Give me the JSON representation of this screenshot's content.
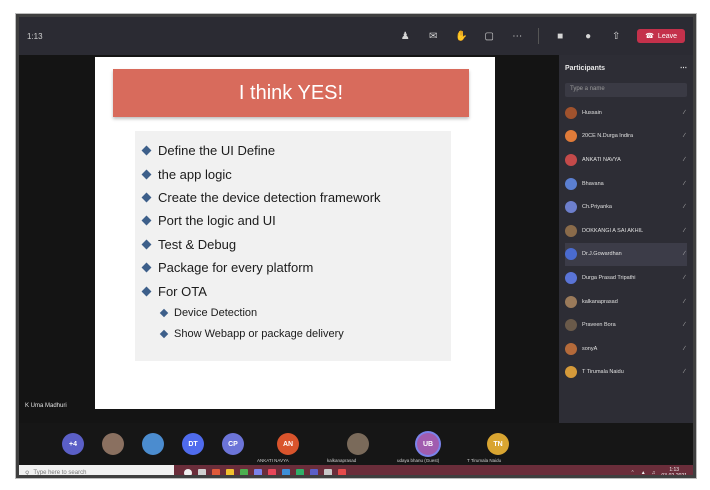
{
  "window": {
    "clock": "1:13"
  },
  "toolbar": {
    "leave_label": "Leave",
    "icons": [
      "people-icon",
      "chat-icon",
      "hand-icon",
      "more-icon",
      "camera-icon",
      "mic-icon",
      "share-icon"
    ]
  },
  "slide": {
    "title": "I think YES!",
    "bullets": [
      "Define the UI Define",
      "the app logic",
      "Create the device detection framework",
      "Port the logic and UI",
      "Test & Debug",
      "Package for every platform",
      "For OTA"
    ],
    "subbullets": [
      "Device Detection",
      "Show Webapp or package delivery"
    ]
  },
  "presenter": {
    "label": "K Uma Madhuri"
  },
  "participants": {
    "title": "Participants",
    "search_placeholder": "Type a name",
    "list": [
      {
        "name": "Hussain",
        "color": "#a0522d"
      },
      {
        "name": "20CE N.Durga Indira",
        "color": "#e07b39"
      },
      {
        "name": "ANKATI NAVYA",
        "color": "#c44a4a"
      },
      {
        "name": "Bhavana",
        "color": "#5b7fd1"
      },
      {
        "name": "Ch.Priyanka",
        "color": "#6d7fcc"
      },
      {
        "name": "DOKKANGI A SAI AKHIL",
        "color": "#8a6b4a"
      },
      {
        "name": "Dr.J.Gowardhan",
        "color": "#4a6bcf"
      },
      {
        "name": "Durga Prasad Tripathi",
        "color": "#5a74d6"
      },
      {
        "name": "kalkanaprasad",
        "color": "#9a7a5a"
      },
      {
        "name": "Praveen Bora",
        "color": "#6a5a4a"
      },
      {
        "name": "sonyA",
        "color": "#b46a3a"
      },
      {
        "name": "T Tirumala Naidu",
        "color": "#d59a3a"
      }
    ]
  },
  "strip": {
    "tiles": [
      {
        "initials": "+4",
        "color": "#5b5fc7"
      },
      {
        "initials": "",
        "color": "#8a7060"
      },
      {
        "initials": "",
        "color": "#4b8ccf"
      },
      {
        "initials": "DT",
        "color": "#4f6bed"
      },
      {
        "initials": "CP",
        "color": "#6c74d8"
      }
    ],
    "named": [
      {
        "initials": "AN",
        "color": "#d9542c",
        "name": "ANKATI NAVYA"
      },
      {
        "initials": "",
        "color": "#7a6a5a",
        "name": "kalkanaprasad"
      },
      {
        "initials": "UB",
        "color": "#a15caf",
        "name": "udaya bhanu (Guest)"
      },
      {
        "initials": "TN",
        "color": "#d9a531",
        "name": "T Tirumala Naidu"
      }
    ]
  },
  "taskbar": {
    "search_placeholder": "Type here to search",
    "time": "1:13",
    "date": "03-02-2021"
  }
}
